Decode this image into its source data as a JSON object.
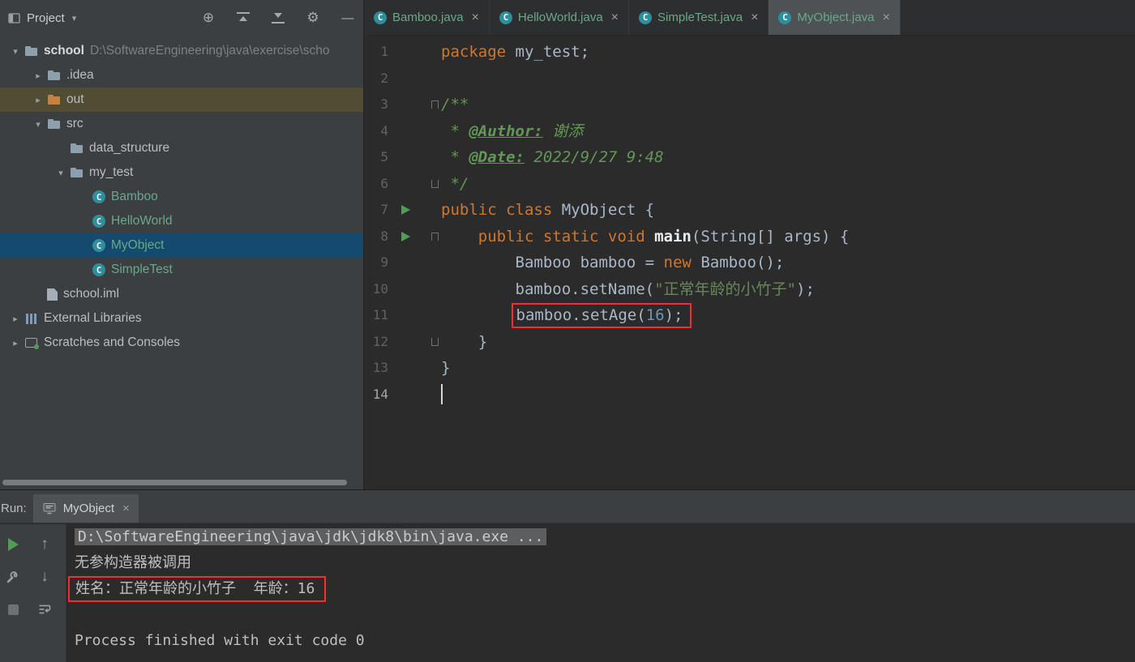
{
  "window": {
    "app": "IntelliJ IDEA"
  },
  "colors": {
    "keyword": "#cc7832",
    "comment": "#629755",
    "string": "#6a8759",
    "number": "#6897bb",
    "code_text": "#a9b7c6",
    "file_teal": "#6aa889",
    "run_green": "#4e9e58",
    "annotation_red": "#ff2b2b",
    "selection_blue": "#15496e",
    "highlight_olive": "#514d35",
    "panel_bg": "#3c3f41",
    "editor_bg": "#2b2b2b"
  },
  "project_panel": {
    "header": {
      "title": "Project",
      "icons": [
        {
          "name": "locate-file-icon",
          "glyph": "⊕"
        },
        {
          "name": "scroll-from-source-icon",
          "shape": "align-top"
        },
        {
          "name": "collapse-all-icon",
          "shape": "align-bottom"
        },
        {
          "name": "settings-gear-icon",
          "glyph": "⚙"
        },
        {
          "name": "hide-panel-icon",
          "glyph": "—"
        }
      ]
    },
    "tree": [
      {
        "label": "school",
        "suffix": "D:\\SoftwareEngineering\\java\\exercise\\scho",
        "type": "project-root",
        "chevron": "expanded",
        "level": 0,
        "bold": true
      },
      {
        "label": ".idea",
        "type": "folder",
        "chevron": "collapsed",
        "level": 1
      },
      {
        "label": "out",
        "type": "folder-excluded",
        "chevron": "collapsed",
        "level": 1,
        "highlighted": true
      },
      {
        "label": "src",
        "type": "folder",
        "chevron": "expanded",
        "level": 1
      },
      {
        "label": "data_structure",
        "type": "package",
        "level": 2
      },
      {
        "label": "my_test",
        "type": "package",
        "chevron": "expanded",
        "level": 2
      },
      {
        "label": "Bamboo",
        "type": "class",
        "level": 3
      },
      {
        "label": "HelloWorld",
        "type": "class",
        "level": 3
      },
      {
        "label": "MyObject",
        "type": "class",
        "level": 3,
        "selected": true
      },
      {
        "label": "SimpleTest",
        "type": "class",
        "level": 3
      },
      {
        "label": "school.iml",
        "type": "file",
        "level": 1
      },
      {
        "label": "External Libraries",
        "type": "libraries",
        "chevron": "collapsed",
        "level": 0
      },
      {
        "label": "Scratches and Consoles",
        "type": "scratches",
        "chevron": "collapsed",
        "level": 0
      }
    ]
  },
  "editor": {
    "tabs": [
      {
        "label": "Bamboo.java"
      },
      {
        "label": "HelloWorld.java"
      },
      {
        "label": "SimpleTest.java"
      },
      {
        "label": "MyObject.java",
        "active": true
      }
    ],
    "lines": [
      {
        "n": 1,
        "seg": [
          [
            "kw",
            "package"
          ],
          [
            "pl",
            " my_test;"
          ]
        ]
      },
      {
        "n": 2,
        "seg": []
      },
      {
        "n": 3,
        "fold": "start",
        "seg": [
          [
            "cm",
            "/**"
          ]
        ]
      },
      {
        "n": 4,
        "seg": [
          [
            "cm",
            " * "
          ],
          [
            "tag",
            "@Author:"
          ],
          [
            "cm",
            " 谢添"
          ]
        ]
      },
      {
        "n": 5,
        "seg": [
          [
            "cm",
            " * "
          ],
          [
            "tag",
            "@Date:"
          ],
          [
            "cm",
            " 2022/9/27 9:48"
          ]
        ]
      },
      {
        "n": 6,
        "fold": "end",
        "seg": [
          [
            "cm",
            " */"
          ]
        ]
      },
      {
        "n": 7,
        "run": true,
        "seg": [
          [
            "kw",
            "public class "
          ],
          [
            "pl",
            "MyObject {"
          ]
        ]
      },
      {
        "n": 8,
        "run": true,
        "fold": "start",
        "seg": [
          [
            "pl",
            "    "
          ],
          [
            "kw",
            "public static void "
          ],
          [
            "mth",
            "main"
          ],
          [
            "pl",
            "(String[] args) {"
          ]
        ]
      },
      {
        "n": 9,
        "seg": [
          [
            "pl",
            "        Bamboo bamboo = "
          ],
          [
            "kw",
            "new"
          ],
          [
            "pl",
            " Bamboo();"
          ]
        ]
      },
      {
        "n": 10,
        "seg": [
          [
            "pl",
            "        bamboo.setName("
          ],
          [
            "str",
            "\"正常年龄的小竹子\""
          ],
          [
            "pl",
            ");"
          ]
        ]
      },
      {
        "n": 11,
        "boxed": true,
        "seg": [
          [
            "pl",
            "        "
          ],
          [
            "pl",
            "bamboo.setAge("
          ],
          [
            "num",
            "16"
          ],
          [
            "pl",
            ");"
          ]
        ]
      },
      {
        "n": 12,
        "fold": "end",
        "seg": [
          [
            "pl",
            "    }"
          ]
        ]
      },
      {
        "n": 13,
        "seg": [
          [
            "pl",
            "}"
          ]
        ]
      },
      {
        "n": 14,
        "cursor": true,
        "seg": []
      }
    ]
  },
  "run_panel": {
    "label": "Run:",
    "tab_label": "MyObject",
    "toolbar": [
      {
        "name": "rerun-icon",
        "shape": "play"
      },
      {
        "name": "scroll-up-icon",
        "glyph": "↑"
      },
      {
        "name": "wrench-icon",
        "shape": "wrench"
      },
      {
        "name": "scroll-down-icon",
        "glyph": "↓"
      },
      {
        "name": "pin-icon",
        "shape": "square"
      },
      {
        "name": "soft-wrap-icon",
        "shape": "softwrap"
      }
    ],
    "console": [
      {
        "cls": "cmd",
        "text": "D:\\SoftwareEngineering\\java\\jdk\\jdk8\\bin\\java.exe ..."
      },
      {
        "cls": "out",
        "text": "无参构造器被调用"
      },
      {
        "cls": "out",
        "boxed": true,
        "text": "姓名：正常年龄的小竹子  年龄：16"
      },
      {
        "cls": "blank",
        "text": ""
      },
      {
        "cls": "out",
        "text": "Process finished with exit code 0"
      }
    ]
  }
}
